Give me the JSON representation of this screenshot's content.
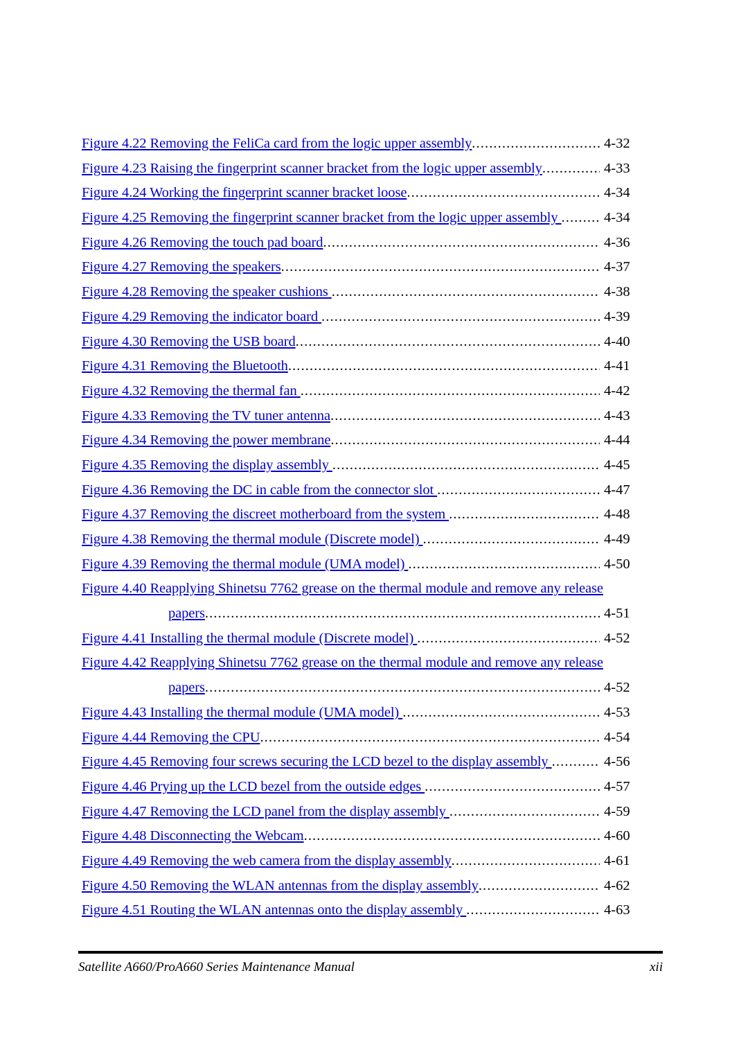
{
  "document": {
    "section_kind": "list-of-figures",
    "link_color": "#0000CC",
    "text_color": "#000000",
    "background_color": "#FFFFFF"
  },
  "entries": [
    {
      "title": "Figure 4.22 Removing the FeliCa card from the logic upper assembly",
      "page": "4-32",
      "wrapped": false
    },
    {
      "title": "Figure 4.23 Raising the fingerprint scanner bracket from the logic upper assembly",
      "page": "4-33",
      "wrapped": false
    },
    {
      "title": "Figure 4.24 Working the fingerprint scanner bracket loose",
      "page": "4-34",
      "wrapped": false
    },
    {
      "title": "Figure 4.25 Removing the fingerprint scanner bracket from the logic upper assembly ",
      "page": "4-34",
      "wrapped": false
    },
    {
      "title": "Figure 4.26 Removing the touch pad board",
      "page": "4-36",
      "wrapped": false
    },
    {
      "title": "Figure 4.27 Removing the speakers",
      "page": "4-37",
      "wrapped": false
    },
    {
      "title": "Figure 4.28 Removing the speaker cushions ",
      "page": "4-38",
      "wrapped": false
    },
    {
      "title": "Figure 4.29 Removing the indicator board ",
      "page": "4-39",
      "wrapped": false
    },
    {
      "title": "Figure 4.30 Removing the USB board",
      "page": "4-40",
      "wrapped": false
    },
    {
      "title": "Figure 4.31 Removing the Bluetooth",
      "page": "4-41",
      "wrapped": false
    },
    {
      "title": "Figure 4.32 Removing the thermal fan ",
      "page": "4-42",
      "wrapped": false
    },
    {
      "title": "Figure 4.33 Removing the TV tuner antenna",
      "page": "4-43",
      "wrapped": false
    },
    {
      "title": "Figure 4.34 Removing the power membrane",
      "page": "4-44",
      "wrapped": false
    },
    {
      "title": "Figure 4.35 Removing the display assembly ",
      "page": "4-45",
      "wrapped": false
    },
    {
      "title": "Figure 4.36 Removing the DC in cable from the connector slot ",
      "page": "4-47",
      "wrapped": false
    },
    {
      "title": "Figure 4.37 Removing the discreet motherboard from the system ",
      "page": "4-48",
      "wrapped": false
    },
    {
      "title": "Figure 4.38 Removing the thermal module (Discrete model) ",
      "page": "4-49",
      "wrapped": false
    },
    {
      "title": "Figure 4.39 Removing the thermal module (UMA model) ",
      "page": "4-50",
      "wrapped": false
    },
    {
      "title": "Figure 4.40 Reapplying Shinetsu 7762 grease on the thermal module  and remove any release",
      "title_cont": "papers",
      "page": "4-51",
      "wrapped": true
    },
    {
      "title": "Figure 4.41 Installing the thermal module (Discrete model) ",
      "page": "4-52",
      "wrapped": false
    },
    {
      "title": "Figure 4.42 Reapplying Shinetsu 7762 grease on the thermal module  and remove any release",
      "title_cont": "papers",
      "page": "4-52",
      "wrapped": true
    },
    {
      "title": "Figure 4.43 Installing the thermal module (UMA model) ",
      "page": "4-53",
      "wrapped": false
    },
    {
      "title": "Figure 4.44 Removing the CPU",
      "page": "4-54",
      "wrapped": false
    },
    {
      "title": "Figure 4.45 Removing four screws securing the LCD bezel to the display assembly ",
      "page": "4-56",
      "wrapped": false
    },
    {
      "title": "Figure 4.46 Prying up the LCD bezel from the outside edges ",
      "page": "4-57",
      "wrapped": false
    },
    {
      "title": "Figure 4.47 Removing the LCD panel from the display assembly ",
      "page": "4-59",
      "wrapped": false
    },
    {
      "title": "Figure 4.48 Disconnecting the Webcam",
      "page": "4-60",
      "wrapped": false
    },
    {
      "title": "Figure 4.49 Removing the web camera from the display assembly",
      "page": "4-61",
      "wrapped": false
    },
    {
      "title": "Figure 4.50 Removing the WLAN antennas from the display assembly",
      "page": "4-62",
      "wrapped": false
    },
    {
      "title": "Figure 4.51 Routing the WLAN antennas onto the display assembly ",
      "page": "4-63",
      "wrapped": false
    }
  ],
  "footer": {
    "manual_title": "Satellite A660/ProA660 Series Maintenance Manual",
    "page_number": "xii"
  }
}
